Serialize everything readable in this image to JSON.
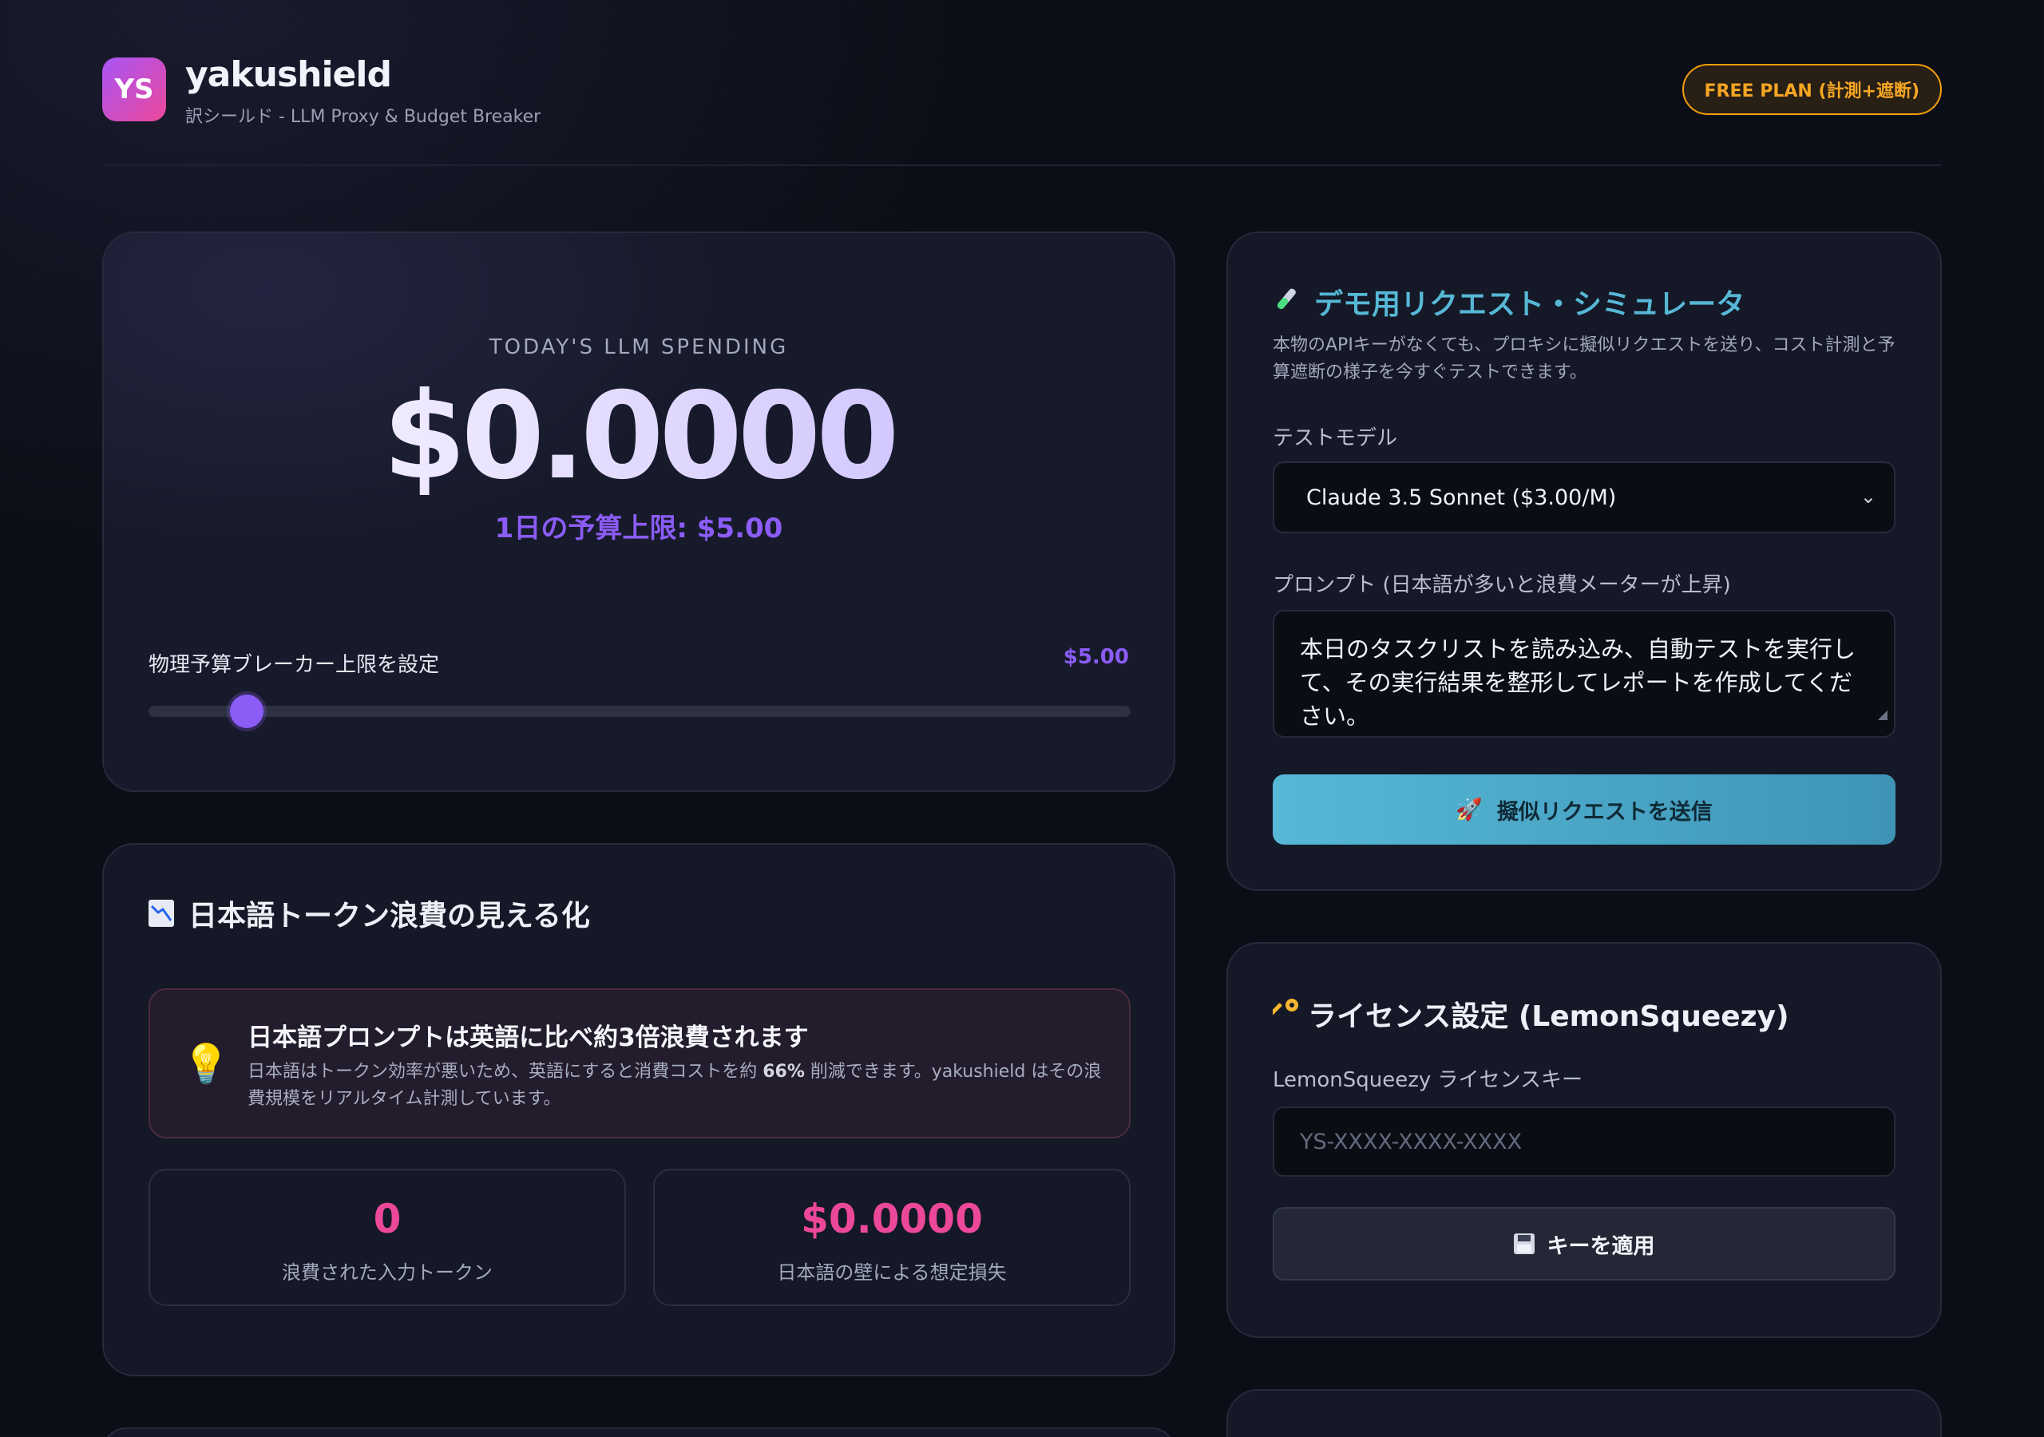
{
  "header": {
    "logo_text": "YS",
    "app_name": "yakushield",
    "subtitle": "訳シールド - LLM Proxy & Budget Breaker",
    "plan_badge": "FREE PLAN (計測+遮断)"
  },
  "spending": {
    "label": "TODAY'S LLM SPENDING",
    "value": "$0.0000",
    "daily_limit": "1日の予算上限: $5.00",
    "breaker_label": "物理予算ブレーカー上限を設定",
    "breaker_value": "$5.00",
    "slider_fraction": 0.1
  },
  "waste": {
    "title": "日本語トークン浪費の見える化",
    "tip_title": "日本語プロンプトは英語に比べ約3倍浪費されます",
    "tip_body_pre": "日本語はトークン効率が悪いため、英語にすると消費コストを約",
    "tip_body_bold": "66%",
    "tip_body_post": "削減できます。yakushield はその浪費規模をリアルタイム計測しています。",
    "stats": [
      {
        "value": "0",
        "label": "浪費された入力トークン"
      },
      {
        "value": "$0.0000",
        "label": "日本語の壁による想定損失"
      }
    ]
  },
  "simulator": {
    "title": "デモ用リクエスト・シミュレータ",
    "description": "本物のAPIキーがなくても、プロキシに擬似リクエストを送り、コスト計測と予算遮断の様子を今すぐテストできます。",
    "model_label": "テストモデル",
    "model_value": "Claude 3.5 Sonnet ($3.00/M)",
    "prompt_label": "プロンプト (日本語が多いと浪費メーターが上昇)",
    "prompt_value": "本日のタスクリストを読み込み、自動テストを実行して、その実行結果を整形してレポートを作成してください。",
    "send_button": "擬似リクエストを送信"
  },
  "license": {
    "title": "ライセンス設定 (LemonSqueezy)",
    "key_label": "LemonSqueezy ライセンスキー",
    "key_placeholder": "YS-XXXX-XXXX-XXXX",
    "apply_button": "キーを適用"
  },
  "icons": {
    "test_tube": "test-tube-icon",
    "chart": "chart-decreasing-icon",
    "bulb": "light-bulb-icon",
    "rocket": "rocket-icon",
    "key": "key-icon",
    "floppy": "floppy-disk-icon",
    "chevron": "chevron-down-icon"
  },
  "colors": {
    "accent_purple": "#8b5cf6",
    "accent_pink": "#ec4899",
    "accent_cyan": "#56b8d6",
    "badge_orange": "#f59e0b"
  }
}
